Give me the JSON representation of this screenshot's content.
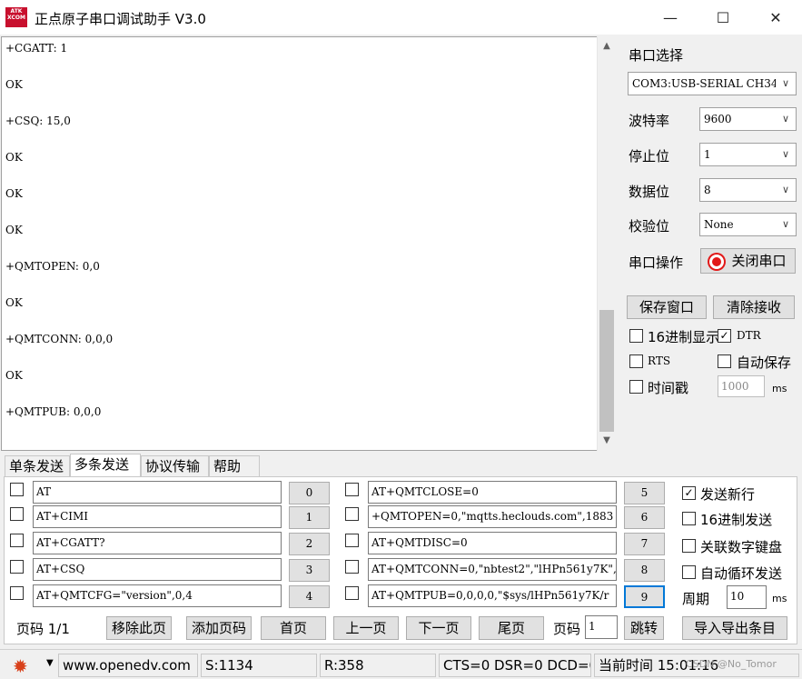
{
  "window": {
    "title": "正点原子串口调试助手 V3.0",
    "logo_text": "ATK XCOM",
    "minimize_glyph": "—",
    "maximize_glyph": "☐",
    "close_glyph": "✕"
  },
  "receive": {
    "lines": [
      "+CGATT: 1",
      "OK",
      "+CSQ: 15,0",
      "OK",
      "OK",
      "OK",
      "+QMTOPEN: 0,0",
      "OK",
      "+QMTCONN: 0,0,0",
      "OK",
      "+QMTPUB: 0,0,0"
    ]
  },
  "settings": {
    "port_select_label": "串口选择",
    "port_value": "COM3:USB-SERIAL CH340",
    "baud_label": "波特率",
    "baud_value": "9600",
    "stopbits_label": "停止位",
    "stopbits_value": "1",
    "databits_label": "数据位",
    "databits_value": "8",
    "parity_label": "校验位",
    "parity_value": "None",
    "port_op_label": "串口操作",
    "close_port_label": "关闭串口",
    "save_window_label": "保存窗口",
    "clear_recv_label": "清除接收",
    "hex_display_label": "16进制显示",
    "dtr_label": "DTR",
    "rts_label": "RTS",
    "auto_save_label": "自动保存",
    "timestamp_label": "时间戳",
    "timestamp_value": "1000",
    "timestamp_unit": "ms"
  },
  "tabs": [
    "单条发送",
    "多条发送",
    "协议传输",
    "帮助"
  ],
  "multi_send": {
    "left": [
      {
        "cmd": "AT",
        "btn": "0"
      },
      {
        "cmd": "AT+CIMI",
        "btn": "1"
      },
      {
        "cmd": "AT+CGATT?",
        "btn": "2"
      },
      {
        "cmd": "AT+CSQ",
        "btn": "3"
      },
      {
        "cmd": "AT+QMTCFG=\"version\",0,4",
        "btn": "4"
      }
    ],
    "right": [
      {
        "cmd": "AT+QMTCLOSE=0",
        "btn": "5"
      },
      {
        "cmd": "+QMTOPEN=0,\"mqtts.heclouds.com\",1883",
        "btn": "6"
      },
      {
        "cmd": "AT+QMTDISC=0",
        "btn": "7"
      },
      {
        "cmd": "AT+QMTCONN=0,\"nbtest2\",\"lHPn561y7K\",",
        "btn": "8"
      },
      {
        "cmd": "AT+QMTPUB=0,0,0,0,\"$sys/lHPn561y7K/r",
        "btn": "9"
      }
    ],
    "options": {
      "send_newline": "发送新行",
      "hex_send": "16进制发送",
      "assoc_keypad": "关联数字键盘",
      "auto_loop": "自动循环发送",
      "period_label": "周期",
      "period_value": "10",
      "period_unit": "ms"
    },
    "pager": {
      "page_info": "页码 1/1",
      "remove_page": "移除此页",
      "add_page": "添加页码",
      "first": "首页",
      "prev": "上一页",
      "next": "下一页",
      "last": "尾页",
      "page_label": "页码",
      "page_value": "1",
      "jump": "跳转",
      "import_export": "导入导出条目"
    }
  },
  "status": {
    "url": "www.openedv.com",
    "sent": "S:1134",
    "received": "R:358",
    "lines": "CTS=0 DSR=0 DCD=0",
    "time": "当前时间 15:01:16"
  },
  "watermark": "CSDN @No_Tomor"
}
